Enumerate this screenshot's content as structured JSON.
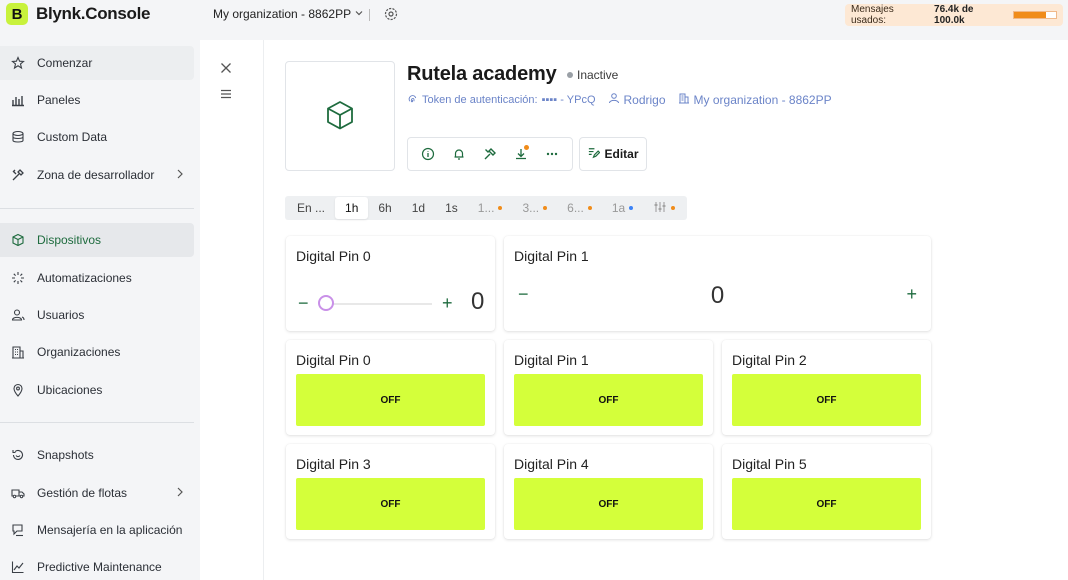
{
  "brand": {
    "logo_letter": "B",
    "name": "Blynk.Console"
  },
  "topbar": {
    "org": "My organization - 8862PP",
    "usage_label": "Mensajes usados:",
    "usage_value": "76.4k de 100.0k",
    "usage_fraction": 0.764
  },
  "sidebar": {
    "items": [
      {
        "label": "Comenzar",
        "icon": "star-icon"
      },
      {
        "label": "Paneles",
        "icon": "bar-chart-icon"
      },
      {
        "label": "Custom Data",
        "icon": "database-icon"
      },
      {
        "label": "Zona de desarrollador",
        "icon": "tools-icon"
      },
      {
        "label": "Dispositivos",
        "icon": "cube-icon"
      },
      {
        "label": "Automatizaciones",
        "icon": "sparkle-icon"
      },
      {
        "label": "Usuarios",
        "icon": "users-icon"
      },
      {
        "label": "Organizaciones",
        "icon": "building-icon"
      },
      {
        "label": "Ubicaciones",
        "icon": "location-pin-icon"
      },
      {
        "label": "Snapshots",
        "icon": "snapshot-icon"
      },
      {
        "label": "Gestión de flotas",
        "icon": "truck-icon"
      },
      {
        "label": "Mensajería en la aplicación",
        "icon": "chat-icon"
      },
      {
        "label": "Predictive Maintenance",
        "icon": "trend-icon"
      }
    ]
  },
  "device": {
    "title": "Rutela academy",
    "status": "Inactive",
    "token_label": "Token de autenticación:",
    "token_value": "▪▪▪▪ - YPcQ",
    "owner": "Rodrigo",
    "organization": "My organization - 8862PP",
    "edit_label": "Editar"
  },
  "time_tabs": [
    {
      "label": "En ...",
      "state": "normal"
    },
    {
      "label": "1h",
      "state": "active"
    },
    {
      "label": "6h",
      "state": "normal"
    },
    {
      "label": "1d",
      "state": "normal"
    },
    {
      "label": "1s",
      "state": "normal"
    },
    {
      "label": "1...",
      "state": "muted",
      "dot": "#f08c1a"
    },
    {
      "label": "3...",
      "state": "muted",
      "dot": "#f08c1a"
    },
    {
      "label": "6...",
      "state": "muted",
      "dot": "#f08c1a"
    },
    {
      "label": "1a",
      "state": "muted",
      "dot": "#3b82f6"
    }
  ],
  "widgets": {
    "slider": {
      "title": "Digital Pin 0",
      "value": "0",
      "fraction": 0
    },
    "stepper": {
      "title": "Digital Pin 1",
      "value": "0"
    },
    "switches": [
      {
        "title": "Digital Pin 0",
        "state": "OFF"
      },
      {
        "title": "Digital Pin 1",
        "state": "OFF"
      },
      {
        "title": "Digital Pin 2",
        "state": "OFF"
      },
      {
        "title": "Digital Pin 3",
        "state": "OFF"
      },
      {
        "title": "Digital Pin 4",
        "state": "OFF"
      },
      {
        "title": "Digital Pin 5",
        "state": "OFF"
      }
    ]
  },
  "colors": {
    "accent": "#1e6b3e",
    "switch_bg": "#d4ff3a",
    "brand": "#c8f23c",
    "link": "#6b84c8",
    "usage_bar": "#f08c1a"
  }
}
